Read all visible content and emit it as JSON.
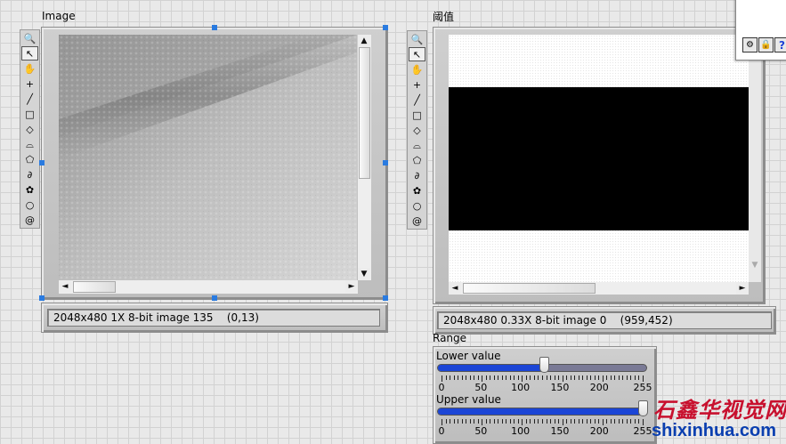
{
  "image_display": {
    "label": "Image",
    "status": "2048x480 1X 8-bit image 135    (0,13)"
  },
  "threshold_display": {
    "label": "阈值",
    "status": "2048x480 0.33X 8-bit image 0    (959,452)"
  },
  "tools": [
    {
      "icon": "zoom-icon",
      "glyph": "🔍"
    },
    {
      "icon": "pointer-icon",
      "glyph": "↖"
    },
    {
      "icon": "pan-hand-icon",
      "glyph": "✋"
    },
    {
      "icon": "point-icon",
      "glyph": "+"
    },
    {
      "icon": "line-icon",
      "glyph": "╱"
    },
    {
      "icon": "rectangle-icon",
      "glyph": "□"
    },
    {
      "icon": "rotated-rectangle-icon",
      "glyph": "◇"
    },
    {
      "icon": "annulus-icon",
      "glyph": "⌓"
    },
    {
      "icon": "polygon-icon",
      "glyph": "⬠"
    },
    {
      "icon": "freehand-line-icon",
      "glyph": "∂"
    },
    {
      "icon": "freehand-region-icon",
      "glyph": "✿"
    },
    {
      "icon": "oval-icon",
      "glyph": "○"
    },
    {
      "icon": "spiral-icon",
      "glyph": "@"
    }
  ],
  "range": {
    "label": "Range",
    "lower_label": "Lower value",
    "upper_label": "Upper value",
    "scale_min": 0,
    "scale_max": 255,
    "scale_labels": [
      "0",
      "50",
      "100",
      "150",
      "200",
      "255"
    ],
    "lower_value": 130,
    "upper_value": 255
  },
  "mini_panel": {
    "icons": [
      "settings-icon",
      "lock-icon",
      "help-icon"
    ],
    "help_glyph": "?"
  },
  "watermark": {
    "cn_text": "石鑫华视觉网",
    "url": "shixinhua.com"
  },
  "colors": {
    "slider_fill": "#1b45d6",
    "slider_track": "#7a7a96",
    "handle": "#2a7be0",
    "watermark_red": "#c8102e",
    "watermark_blue": "#0a3fb0"
  }
}
